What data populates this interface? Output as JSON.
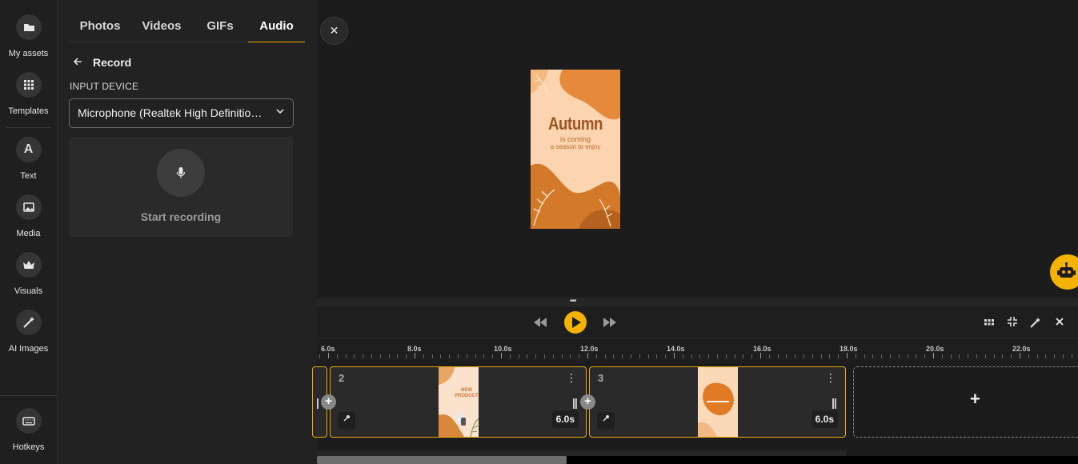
{
  "rail": {
    "items": [
      {
        "label": "My assets",
        "icon": "folder-icon"
      },
      {
        "label": "Templates",
        "icon": "grid-icon"
      },
      {
        "label": "Text",
        "icon": "text-icon"
      },
      {
        "label": "Media",
        "icon": "image-icon"
      },
      {
        "label": "Visuals",
        "icon": "crown-icon"
      },
      {
        "label": "AI Images",
        "icon": "magic-wand-icon"
      }
    ],
    "hotkeys": "Hotkeys"
  },
  "panel": {
    "tabs": [
      "Photos",
      "Videos",
      "GIFs",
      "Audio"
    ],
    "active_tab": "Audio",
    "back_title": "Record",
    "input_device_label": "INPUT DEVICE",
    "input_device_value": "Microphone (Realtek High Definition Audio)",
    "start_recording": "Start recording"
  },
  "preview": {
    "headline": "Autumn",
    "line1": "is coming",
    "line2": "a season to enjoy",
    "accent": "#f5b301"
  },
  "timeline": {
    "ruler": [
      "6.0s",
      "8.0s",
      "10.0s",
      "12.0s",
      "14.0s",
      "16.0s",
      "18.0s",
      "20.0s",
      "22.0s"
    ],
    "clips": [
      {
        "number": "2",
        "duration": "6.0s",
        "thumb_text": [
          "NEW",
          "PRODUCTS"
        ]
      },
      {
        "number": "3",
        "duration": "6.0s"
      }
    ],
    "add_label": "+"
  }
}
